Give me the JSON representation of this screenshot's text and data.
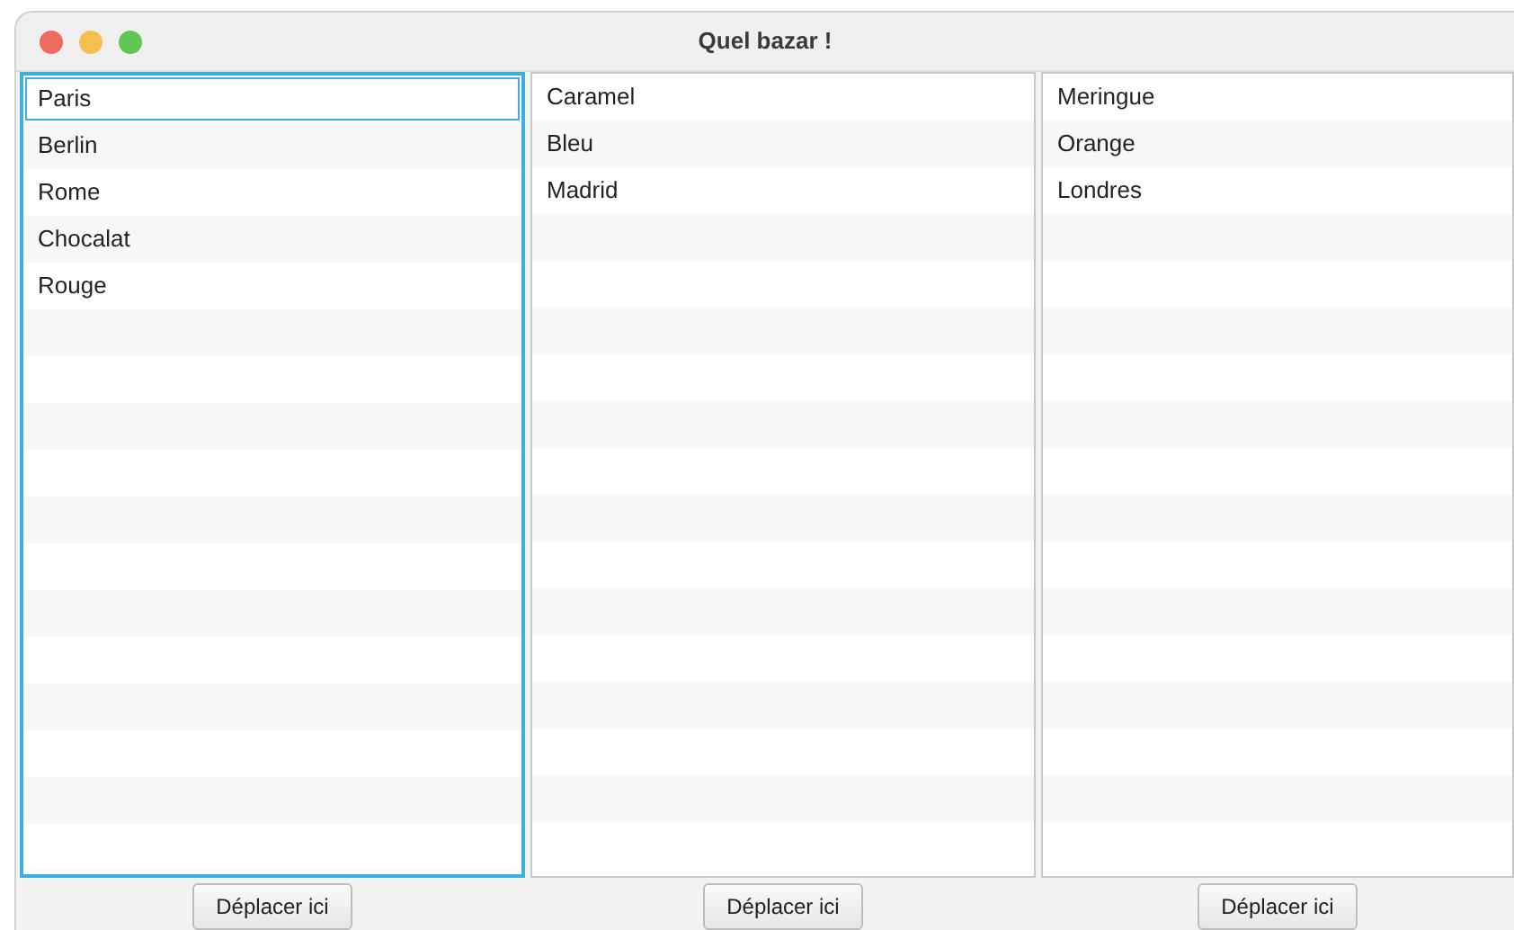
{
  "window": {
    "title": "Quel bazar !"
  },
  "lists": [
    {
      "focused": true,
      "items": [
        {
          "label": "Paris",
          "focused": true
        },
        {
          "label": "Berlin",
          "focused": false
        },
        {
          "label": "Rome",
          "focused": false
        },
        {
          "label": "Chocalat",
          "focused": false
        },
        {
          "label": "Rouge",
          "focused": false
        }
      ],
      "button": "Déplacer ici"
    },
    {
      "focused": false,
      "items": [
        {
          "label": "Caramel",
          "focused": false
        },
        {
          "label": "Bleu",
          "focused": false
        },
        {
          "label": "Madrid",
          "focused": false
        }
      ],
      "button": "Déplacer ici"
    },
    {
      "focused": false,
      "items": [
        {
          "label": "Meringue",
          "focused": false
        },
        {
          "label": "Orange",
          "focused": false
        },
        {
          "label": "Londres",
          "focused": false
        }
      ],
      "button": "Déplacer ici"
    }
  ]
}
